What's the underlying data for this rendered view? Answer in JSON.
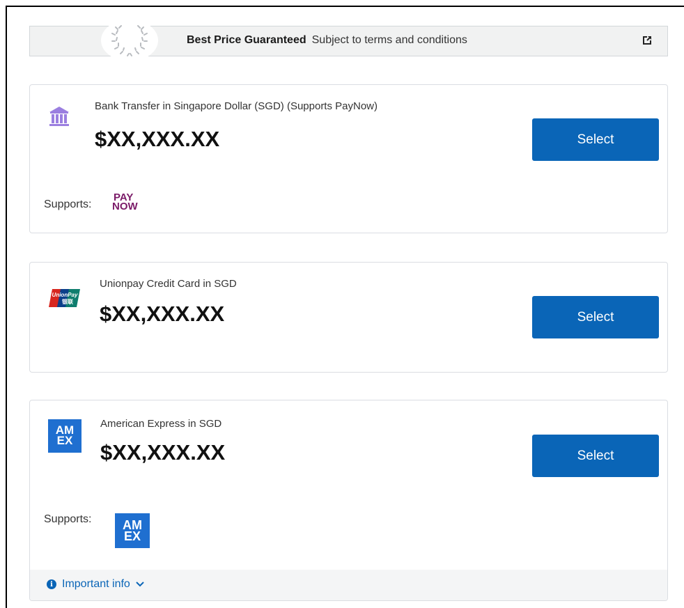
{
  "banner": {
    "title": "Best Price Guaranteed",
    "subtitle": "Subject to terms and conditions",
    "icon": "external-link-icon"
  },
  "payment_methods": [
    {
      "title": "Bank Transfer in Singapore Dollar (SGD) (Supports PayNow)",
      "price": "$XX,XXX.XX",
      "button_label": "Select",
      "icon": "bank-icon",
      "supports_label": "Supports:",
      "supports_logo": {
        "line1": "PAY",
        "line2": "NOW"
      }
    },
    {
      "title": "Unionpay Credit Card in SGD",
      "price": "$XX,XXX.XX",
      "button_label": "Select",
      "icon": "unionpay-logo",
      "logo_text": "UnionPay",
      "logo_text_cn": "银联"
    },
    {
      "title": "American Express in SGD",
      "price": "$XX,XXX.XX",
      "button_label": "Select",
      "icon": "amex-logo",
      "logo_line1": "AM",
      "logo_line2": "EX",
      "supports_label": "Supports:",
      "supports_logo": {
        "line1": "AM",
        "line2": "EX"
      }
    }
  ],
  "important_info": {
    "label": "Important info",
    "icon": "info-icon",
    "chevron": "chevron-down-icon"
  },
  "colors": {
    "accent": "#0a65b7",
    "bank_icon": "#9b7fe0",
    "paynow": "#7b1b68",
    "amex": "#1f6fd0"
  }
}
